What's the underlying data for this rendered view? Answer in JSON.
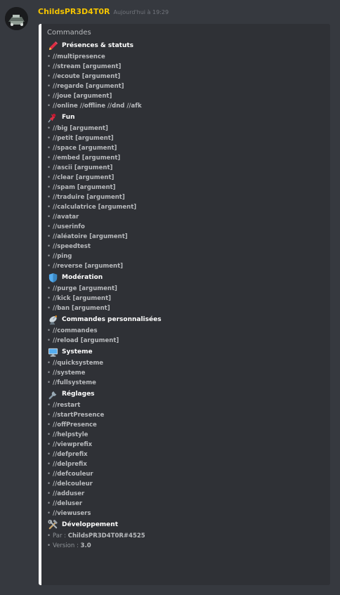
{
  "message": {
    "username": "ChildsPR3D4T0R",
    "timestamp": "Aujourd'hui à 19:29"
  },
  "embed": {
    "title": "Commandes",
    "sections": [
      {
        "icon": "pencil-icon",
        "title": "Présences & statuts",
        "commands": [
          "//multipresence",
          "//stream [argument]",
          "//ecoute [argument]",
          "//regarde [argument]",
          "//joue [argument]",
          "//online //offline //dnd //afk"
        ]
      },
      {
        "icon": "pushpin-icon",
        "title": "Fun",
        "commands": [
          "//big [argument]",
          "//petit [argument]",
          "//space [argument]",
          "//embed [argument]",
          "//ascii [argument]",
          "//clear [argument]",
          "//spam [argument]",
          "//traduire [argument]",
          "//calculatrice [argument]",
          "//avatar",
          "//userinfo",
          "//aléatoire [argument]",
          "//speedtest",
          "//ping",
          "//reverse [argument]"
        ]
      },
      {
        "icon": "shield-icon",
        "title": "Modération",
        "commands": [
          "//purge [argument]",
          "//kick [argument]",
          "//ban [argument]"
        ]
      },
      {
        "icon": "satellite-dish-icon",
        "title": "Commandes personnalisées",
        "commands": [
          "//commandes",
          "//reload [argument]"
        ]
      },
      {
        "icon": "computer-icon",
        "title": "Systeme",
        "commands": [
          "//quicksysteme",
          "//systeme",
          "//fullsysteme"
        ]
      },
      {
        "icon": "wrench-icon",
        "title": "Réglages",
        "commands": [
          "//restart",
          "//startPresence",
          "//offPresence",
          "//helpstyle",
          "//viewprefix",
          "//defprefix",
          "//delprefix",
          "//defcouleur",
          "//delcouleur",
          "//adduser",
          "//deluser",
          "//viewusers"
        ]
      }
    ],
    "development": {
      "icon": "hammer-wrench-icon",
      "title": "Développement",
      "author_label": "Par :",
      "author": "ChildsPR3D4T0R#4525",
      "version_label": "Version :",
      "version": "3.0"
    }
  },
  "colors": {
    "background": "#36393f",
    "embed_background": "#2f3136",
    "embed_border": "#ffffff",
    "username": "#f5c400"
  }
}
